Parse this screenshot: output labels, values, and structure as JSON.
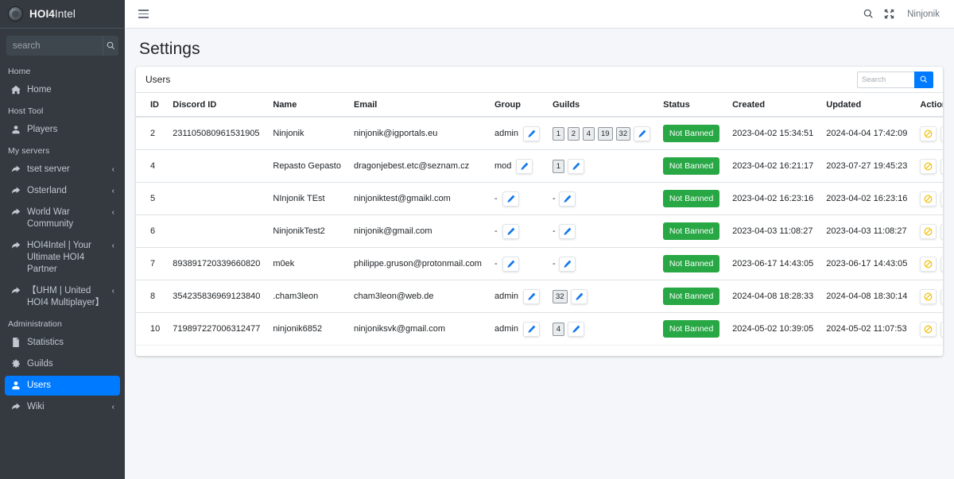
{
  "brand": {
    "bold": "HOI4",
    "light": "Intel",
    "logo_icon": "globe-logo-icon"
  },
  "sidebar": {
    "search": {
      "placeholder": "search",
      "value": "",
      "button_icon": "search-icon"
    },
    "sections": [
      {
        "header": "Home",
        "items": [
          {
            "label": "Home",
            "icon": "home-icon",
            "chevron": false,
            "active": false
          }
        ]
      },
      {
        "header": "Host Tool",
        "items": [
          {
            "label": "Players",
            "icon": "user-icon",
            "chevron": false,
            "active": false
          }
        ]
      },
      {
        "header": "My servers",
        "items": [
          {
            "label": "tset server",
            "icon": "share-icon",
            "chevron": true,
            "active": false
          },
          {
            "label": "Osterland",
            "icon": "share-icon",
            "chevron": true,
            "active": false
          },
          {
            "label": "World War Community",
            "icon": "share-icon",
            "chevron": true,
            "active": false
          },
          {
            "label": "HOI4Intel | Your Ultimate HOI4 Partner",
            "icon": "share-icon",
            "chevron": true,
            "active": false
          },
          {
            "label": "【UHM | United HOI4 Multiplayer】",
            "icon": "share-icon",
            "chevron": true,
            "active": false
          }
        ]
      },
      {
        "header": "Administration",
        "items": [
          {
            "label": "Statistics",
            "icon": "file-icon",
            "chevron": false,
            "active": false
          },
          {
            "label": "Guilds",
            "icon": "gear-icon",
            "chevron": false,
            "active": false
          },
          {
            "label": "Users",
            "icon": "user-icon",
            "chevron": false,
            "active": true
          },
          {
            "label": "Wiki",
            "icon": "share-icon",
            "chevron": true,
            "active": false
          }
        ]
      }
    ],
    "chevron_glyph": "‹"
  },
  "topbar": {
    "menu_icon": "hamburger-icon",
    "search_icon": "search-icon",
    "fullscreen_icon": "expand-arrows-icon",
    "username": "Ninjonik"
  },
  "page": {
    "title": "Settings"
  },
  "card": {
    "title": "Users",
    "search": {
      "placeholder": "Search",
      "value": "",
      "button_icon": "search-icon"
    }
  },
  "table": {
    "columns": [
      "ID",
      "Discord ID",
      "Name",
      "Email",
      "Group",
      "Guilds",
      "Status",
      "Created",
      "Updated",
      "Actions"
    ],
    "edit_icon": "pencil-icon",
    "ban_icon": "ban-icon",
    "delete_icon": "trash-icon",
    "rows": [
      {
        "id": "2",
        "discord_id": "231105080961531905",
        "name": "Ninjonik",
        "email": "ninjonik@igportals.eu",
        "group": "admin",
        "guilds": [
          "1",
          "2",
          "4",
          "19",
          "32"
        ],
        "status": "Not Banned",
        "created": "2023-04-02 15:34:51",
        "updated": "2024-04-04 17:42:09"
      },
      {
        "id": "4",
        "discord_id": "",
        "name": "Repasto Gepasto",
        "email": "dragonjebest.etc@seznam.cz",
        "group": "mod",
        "guilds": [
          "1"
        ],
        "status": "Not Banned",
        "created": "2023-04-02 16:21:17",
        "updated": "2023-07-27 19:45:23"
      },
      {
        "id": "5",
        "discord_id": "",
        "name": "NInjonik TEst",
        "email": "ninjoniktest@gmaikl.com",
        "group": "-",
        "guilds": [
          "-"
        ],
        "status": "Not Banned",
        "created": "2023-04-02 16:23:16",
        "updated": "2023-04-02 16:23:16"
      },
      {
        "id": "6",
        "discord_id": "",
        "name": "NinjonikTest2",
        "email": "ninjonik@gmail.com",
        "group": "-",
        "guilds": [
          "-"
        ],
        "status": "Not Banned",
        "created": "2023-04-03 11:08:27",
        "updated": "2023-04-03 11:08:27"
      },
      {
        "id": "7",
        "discord_id": "893891720339660820",
        "name": "m0ek",
        "email": "philippe.gruson@protonmail.com",
        "group": "-",
        "guilds": [
          "-"
        ],
        "status": "Not Banned",
        "created": "2023-06-17 14:43:05",
        "updated": "2023-06-17 14:43:05"
      },
      {
        "id": "8",
        "discord_id": "354235836969123840",
        "name": ".cham3leon",
        "email": "cham3leon@web.de",
        "group": "admin",
        "guilds": [
          "32"
        ],
        "status": "Not Banned",
        "created": "2024-04-08 18:28:33",
        "updated": "2024-04-08 18:30:14"
      },
      {
        "id": "10",
        "discord_id": "719897227006312477",
        "name": "ninjonik6852",
        "email": "ninjoniksvk@gmail.com",
        "group": "admin",
        "guilds": [
          "4"
        ],
        "status": "Not Banned",
        "created": "2024-05-02 10:39:05",
        "updated": "2024-05-02 11:07:53"
      }
    ]
  },
  "colors": {
    "sidebar_bg": "#343a40",
    "accent": "#007bff",
    "status_green": "#28a745",
    "danger_red": "#dc3545",
    "warning_yellow": "#ffc107"
  }
}
